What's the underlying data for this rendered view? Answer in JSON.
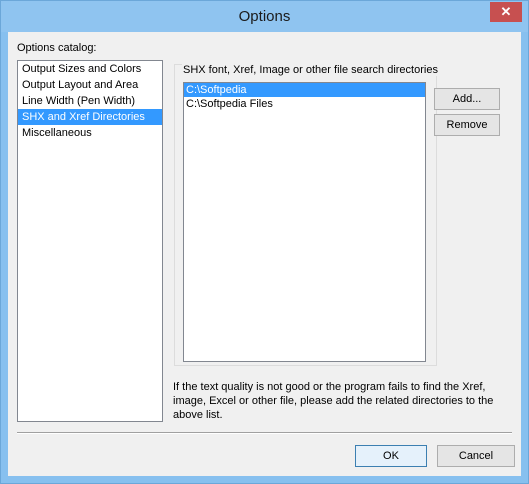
{
  "window": {
    "title": "Options",
    "close_glyph": "✕"
  },
  "catalog": {
    "label": "Options catalog:",
    "items": [
      {
        "label": "Output Sizes and Colors",
        "selected": false
      },
      {
        "label": "Output Layout and Area",
        "selected": false
      },
      {
        "label": "Line Width (Pen Width)",
        "selected": false
      },
      {
        "label": "SHX and Xref Directories",
        "selected": true
      },
      {
        "label": "Miscellaneous",
        "selected": false
      }
    ]
  },
  "directories": {
    "group_label": "SHX font, Xref, Image or other file search directories",
    "items": [
      {
        "label": "C:\\Softpedia",
        "selected": true
      },
      {
        "label": "C:\\Softpedia Files",
        "selected": false
      }
    ],
    "add_label": "Add...",
    "remove_label": "Remove"
  },
  "info_text": "If the text quality is not good or the program fails to find the Xref, image, Excel or other file, please add the related directories to the above list.",
  "footer": {
    "ok_label": "OK",
    "cancel_label": "Cancel"
  },
  "colors": {
    "titlebar": "#8fc4f0",
    "selection": "#3399ff",
    "close": "#c75050"
  }
}
